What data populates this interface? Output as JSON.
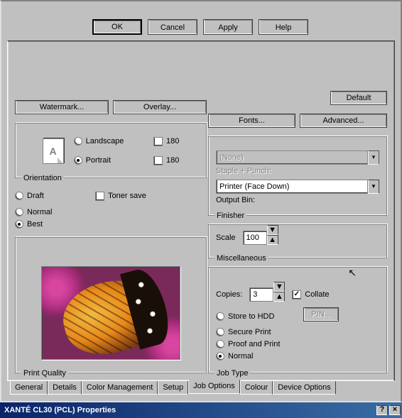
{
  "title": "XANTÉ CL30 (PCL) Properties",
  "titlebar": {
    "help": "?",
    "close": "×"
  },
  "tabs": [
    "General",
    "Details",
    "Color Management",
    "Setup",
    "Job Options",
    "Colour",
    "Device Options"
  ],
  "active_tab": 4,
  "sub_buttons": {
    "watermark": "Watermark...",
    "overlay": "Overlay...",
    "fonts": "Fonts...",
    "advanced": "Advanced..."
  },
  "default_button": "Default",
  "print_quality": {
    "title": "Print Quality",
    "items": [
      "Best",
      "Normal",
      "Draft"
    ],
    "selected": "Best",
    "toner_save": "Toner save",
    "toner_save_checked": false
  },
  "orientation": {
    "title": "Orientation",
    "items": [
      "Portrait",
      "Landscape"
    ],
    "selected": "Portrait",
    "rotate180_a": "180",
    "rotate180_b": "180"
  },
  "job_type": {
    "title": "Job Type",
    "items": [
      "Normal",
      "Proof and Print",
      "Secure Print",
      "Store to HDD"
    ],
    "selected": "Normal",
    "copies_label": "Copies:",
    "copies_value": "3",
    "collate": "Collate",
    "collate_checked": true,
    "pin_button": "PIN..."
  },
  "misc": {
    "title": "Miscellaneous",
    "scale_label": "Scale",
    "scale_value": "100"
  },
  "finisher": {
    "title": "Finisher",
    "output_bin_label": "Output Bin:",
    "output_bin_value": "Printer (Face Down)",
    "staple_label": "Staple + Punch:",
    "staple_value": "(None)"
  },
  "footer": {
    "ok": "OK",
    "cancel": "Cancel",
    "apply": "Apply",
    "help": "Help"
  }
}
